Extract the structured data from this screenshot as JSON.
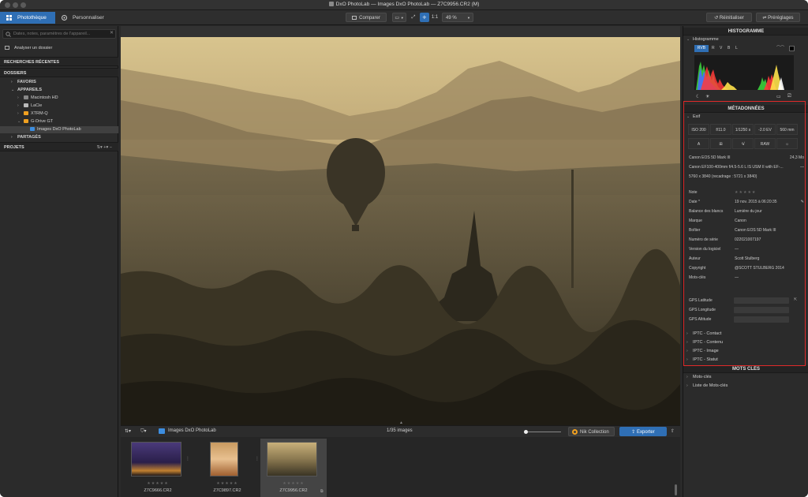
{
  "window": {
    "title": "DxO PhotoLab — Images DxO PhotoLab — Z7C9956.CR2 (M)"
  },
  "toolbar": {
    "tabs": [
      {
        "label": "Photothèque",
        "active": true,
        "icon": "grid-icon"
      },
      {
        "label": "Personnaliser",
        "active": false,
        "icon": "palette-icon"
      }
    ],
    "compare_label": "Comparer",
    "ratio_label": "1:1",
    "zoom_value": "49 %",
    "reset_label": "Réinitialiser",
    "presets_label": "Préréglages"
  },
  "sidebar": {
    "search_placeholder": "Dates, notes, paramètres de l'appareil...",
    "analyze_label": "Analyser un dossier",
    "recent_searches": "RECHERCHES RÉCENTES",
    "folders_header": "DOSSIERS",
    "favorites": "FAVORIS",
    "devices": "APPAREILS",
    "volumes": [
      "Macintosh HD",
      "LaCie",
      "XTRM-Q",
      "G-Drive GT"
    ],
    "selected_folder": "Images DxO PhotoLab",
    "shared": "PARTAGÉS",
    "projects": "PROJETS",
    "accent_color": "#f0a020"
  },
  "filmstrip": {
    "folder_name": "Images DxO PhotoLab",
    "count": "1/35 images",
    "nik_label": "Nik Collection",
    "export_label": "Exporter",
    "items": [
      {
        "name": "Z7C9666.CR2",
        "stars": "★★★★★"
      },
      {
        "name": "Z7C9897.CR2",
        "stars": "★★★★★"
      },
      {
        "name": "Z7C9956.CR2",
        "stars": "★★★★★"
      }
    ]
  },
  "histogram": {
    "section_title": "HISTOGRAMME",
    "subtitle": "Histogramme",
    "channels": [
      "RVB",
      "R",
      "V",
      "B",
      "L"
    ]
  },
  "metadata": {
    "section_title": "MÉTADONNÉES",
    "exif_label": "Exif",
    "exif_cells": [
      "ISO 200",
      "f/11.0",
      "1/1250 s",
      "-2.0 EV",
      "560 mm"
    ],
    "exif_icons": [
      "A",
      "RAW"
    ],
    "camera": "Canon EOS 5D Mark III",
    "file_size": "24,3 Mo",
    "lens": "Canon EF100-400mm f/4.5-5.6 L IS USM II with EF-...",
    "lens_more": "—",
    "dimensions": "5760 x 3840 (recadrage : 5721 x 3840)",
    "fields": [
      {
        "k": "Note",
        "v": "★★★★★"
      },
      {
        "k": "Date *",
        "v": "19 nov. 2015 à 06:20:35"
      },
      {
        "k": "Balance des blancs",
        "v": "Lumière du jour"
      },
      {
        "k": "Marque",
        "v": "Canon"
      },
      {
        "k": "Boîtier",
        "v": "Canon EOS 5D Mark III"
      },
      {
        "k": "Numéro de série",
        "v": "022021007197"
      },
      {
        "k": "Version du logiciel",
        "v": "—"
      },
      {
        "k": "Auteur",
        "v": "Scott Stulberg"
      },
      {
        "k": "Copyright",
        "v": "@SCOTT STULBERG 2014"
      },
      {
        "k": "Mots-clés",
        "v": "—"
      }
    ],
    "gps": [
      "GPS Latitude",
      "GPS Longitude",
      "GPS Altitude"
    ],
    "iptc": [
      "IPTC - Contact",
      "IPTC - Contenu",
      "IPTC - Image",
      "IPTC - Statut"
    ]
  },
  "keywords": {
    "section_title": "MOTS CLÉS",
    "items": [
      "Mots-clés",
      "Liste de Mots-clés"
    ]
  }
}
